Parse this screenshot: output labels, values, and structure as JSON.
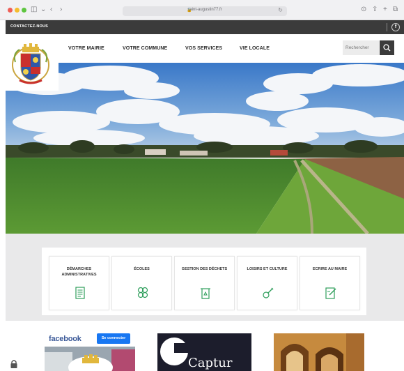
{
  "browser": {
    "url": "saint-augustin77.fr"
  },
  "topbar": {
    "contact_label": "CONTACTEZ-NOUS"
  },
  "nav": {
    "items": [
      {
        "label": "VOTRE MAIRIE"
      },
      {
        "label": "VOTRE COMMUNE"
      },
      {
        "label": "VOS SERVICES"
      },
      {
        "label": "VIE LOCALE"
      }
    ],
    "search_placeholder": "Rechercher"
  },
  "services": {
    "cards": [
      {
        "label": "DÉMARCHES ADMINISTRATIVES",
        "icon": "document-icon"
      },
      {
        "label": "ÉCOLES",
        "icon": "blocks-icon"
      },
      {
        "label": "GESTION DES DÉCHETS",
        "icon": "recycle-bin-icon"
      },
      {
        "label": "LOISIRS ET CULTURE",
        "icon": "guitar-icon"
      },
      {
        "label": "ECRIRE AU MAIRE",
        "icon": "write-icon"
      }
    ],
    "icon_color": "#2e9e5b"
  },
  "social": {
    "facebook_word": "facebook",
    "connect_label": "Se connecter"
  },
  "tiles": {
    "dark_tile_text": "Captur"
  },
  "colors": {
    "topbar": "#3b3b3b",
    "band": "#e9e9ea",
    "facebook_blue": "#1877f2"
  }
}
